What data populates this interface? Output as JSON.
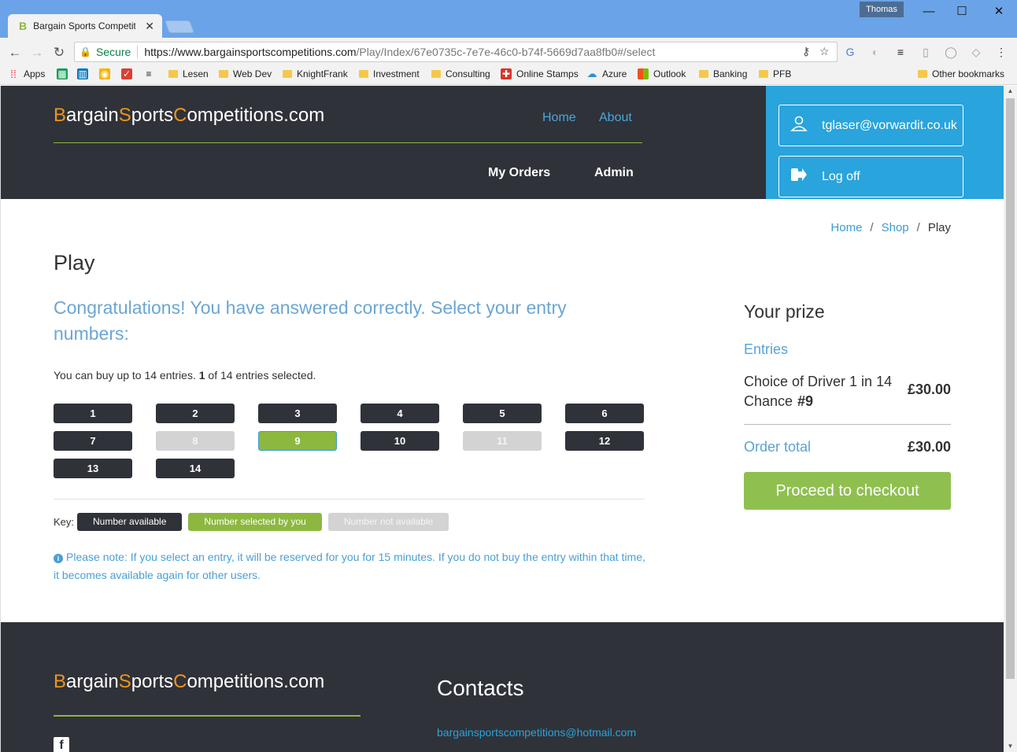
{
  "browser": {
    "tab_title": "Bargain Sports Competiti",
    "tab_favicon": "B",
    "user": "Thomas",
    "secure_label": "Secure",
    "url_scheme_host": "https://www.bargainsportscompetitions.com",
    "url_path": "/Play/Index/67e0735c-7e7e-46c0-b74f-5669d7aa8fb0#/select"
  },
  "bookmarks": {
    "apps": "Apps",
    "items": [
      "Lesen",
      "Web Dev",
      "KnightFrank",
      "Investment",
      "Consulting",
      "Online Stamps",
      "Azure",
      "Outlook",
      "Banking",
      "PFB"
    ],
    "other": "Other bookmarks"
  },
  "site": {
    "logo_parts": [
      "B",
      "argain",
      "S",
      "ports",
      "C",
      "ompetitions.com"
    ],
    "nav_top": [
      "Home",
      "About"
    ],
    "nav_bottom": [
      "My Orders",
      "Admin"
    ],
    "user_email": "tglaser@vorwardit.co.uk",
    "logoff": "Log off"
  },
  "breadcrumb": [
    "Home",
    "Shop",
    "Play"
  ],
  "breadcrumb_sep": "/",
  "page": {
    "title": "Play",
    "congrats": "Congratulations! You have answered correctly. Select your entry numbers:",
    "info_pre": "You can buy up to 14 entries.",
    "info_count": "1",
    "info_post": "of 14 entries selected.",
    "numbers": [
      {
        "n": "1",
        "state": "available"
      },
      {
        "n": "2",
        "state": "available"
      },
      {
        "n": "3",
        "state": "available"
      },
      {
        "n": "4",
        "state": "available"
      },
      {
        "n": "5",
        "state": "available"
      },
      {
        "n": "6",
        "state": "available"
      },
      {
        "n": "7",
        "state": "available"
      },
      {
        "n": "8",
        "state": "unavailable"
      },
      {
        "n": "9",
        "state": "selected"
      },
      {
        "n": "10",
        "state": "available"
      },
      {
        "n": "11",
        "state": "unavailable"
      },
      {
        "n": "12",
        "state": "available"
      },
      {
        "n": "13",
        "state": "available"
      },
      {
        "n": "14",
        "state": "available"
      }
    ],
    "key_label": "Key:",
    "key_available": "Number available",
    "key_selected": "Number selected by you",
    "key_unavailable": "Number not available",
    "note": "Please note: If you select an entry, it will be reserved for you for 15 minutes. If you do not buy the entry within that time, it becomes available again for other users."
  },
  "prize": {
    "heading": "Your prize",
    "entries_label": "Entries",
    "entry_name": "Choice of Driver 1 in 14 Chance",
    "entry_number": "#9",
    "entry_price": "£30.00",
    "total_label": "Order total",
    "total_value": "£30.00",
    "checkout": "Proceed to checkout"
  },
  "footer": {
    "contacts": "Contacts",
    "email": "bargainsportscompetitions@hotmail.com",
    "social_icon": "facebook-icon"
  },
  "colors": {
    "dark": "#2f3239",
    "green": "#8cb83f",
    "blue": "#29a4dc",
    "orange": "#f0951a",
    "grey": "#d3d3d3"
  }
}
